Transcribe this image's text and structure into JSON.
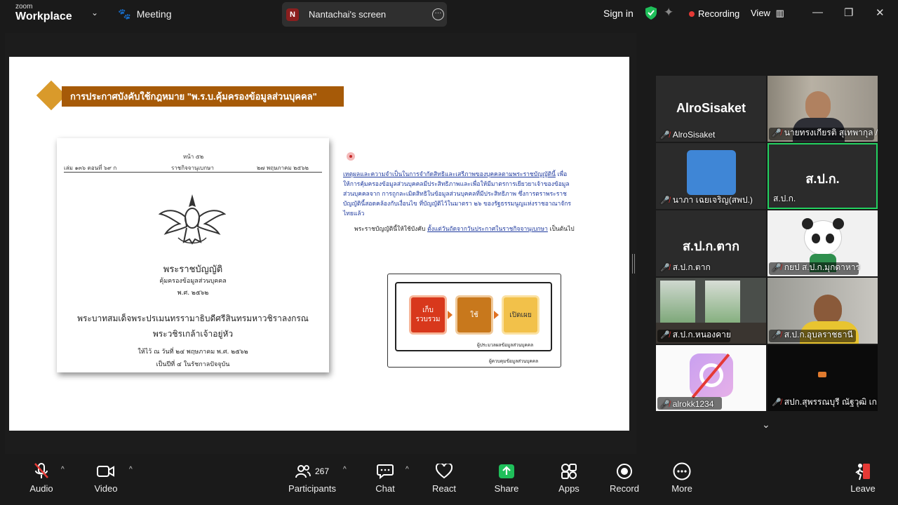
{
  "app": {
    "brand_small": "zoom",
    "brand_big": "Workplace"
  },
  "topbar": {
    "meeting_label": "Meeting",
    "share_initial": "N",
    "share_label": "Nantachai's screen",
    "signin": "Sign in",
    "recording": "Recording",
    "view": "View"
  },
  "slide": {
    "title": "การประกาศบังคับใช้กฎหมาย \"พ.ร.บ.คุ้มครองข้อมูลส่วนบุคคล\"",
    "doc": {
      "page": "หน้า ๕๒",
      "vol": "เล่ม ๑๓๖ ตอนที่ ๖๙ ก",
      "gazette": "ราชกิจจานุเบกษา",
      "date": "๒๗ พฤษภาคม ๒๕๖๒",
      "act": "พระราชบัญญัติ",
      "act_sub": "คุ้มครองข้อมูลส่วนบุคคล",
      "act_year": "พ.ศ. ๒๕๖๒",
      "king1": "พระบาทสมเด็จพระปรเมนทรรามาธิบดีศรีสินทรมหาวชิราลงกรณ",
      "king2": "พระวชิรเกล้าเจ้าอยู่หัว",
      "given": "ให้ไว้ ณ วันที่ ๒๔ พฤษภาคม พ.ศ. ๒๕๖๒",
      "reign": "เป็นปีที่ ๔ ในรัชกาลปัจจุบัน"
    },
    "para1_link": "เหตุผลและความจำเป็นในการจำกัดสิทธิและเสรีภาพของบุคคลตามพระราชบัญญัตินี้",
    "para1_text": "เพื่อให้การคุ้มครองข้อมูลส่วนบุคคลมีประสิทธิภาพและเพื่อให้มีมาตรการเยียวยาเจ้าของข้อมูลส่วนบุคคลจาก การถูกละเมิดสิทธิในข้อมูลส่วนบุคคลที่มีประสิทธิภาพ ซึ่งการตราพระราชบัญญัตินี้สอดคล้องกับเงื่อนไข ที่บัญญัติไว้ในมาตรา ๒๖ ของรัฐธรรมนูญแห่งราชอาณาจักรไทยแล้ว",
    "para2_text": "พระราชบัญญัตินี้ให้ใช้บังคับ",
    "para2_link": "ตั้งแต่วันถัดจากวันประกาศในราชกิจจานุเบกษา",
    "para2_end": "เป็นต้นไป",
    "flow": {
      "collect": "เก็บ รวบรวม",
      "use": "ใช้",
      "disclose": "เปิดเผย",
      "processor": "ผู้ประมวลผลข้อมูลส่วนบุคคล",
      "controller": "ผู้ควบคุมข้อมูลส่วนบุคคล"
    }
  },
  "participants_gallery": [
    {
      "name": "AlroSisaket",
      "big": "AlroSisaket"
    },
    {
      "name": "นายทรงเกียรติ สุเทพากุล /..."
    },
    {
      "name": "นาภา เฉยเจริญ(สพป.)"
    },
    {
      "name": "ส.ป.ก.",
      "big": "ส.ป.ก."
    },
    {
      "name": "ส.ป.ก.ตาก",
      "big": "ส.ป.ก.ตาก"
    },
    {
      "name": "กยป ส.ป.ก.มุกดาหาร"
    },
    {
      "name": "ส.ป.ก.หนองคาย"
    },
    {
      "name": "ส.ป.ก.อุบลราชธานี"
    },
    {
      "name": "alrokk1234"
    },
    {
      "name": "สปก.สุพรรณบุรี ณัฐวุฒิ เก..."
    }
  ],
  "toolbar": {
    "audio": "Audio",
    "video": "Video",
    "participants": "Participants",
    "participants_count": "267",
    "chat": "Chat",
    "react": "React",
    "share": "Share",
    "apps": "Apps",
    "record": "Record",
    "more": "More",
    "leave": "Leave"
  },
  "colors": {
    "accent_green": "#1fbf5a",
    "record_red": "#e53935",
    "title_brown": "#a65a08"
  }
}
